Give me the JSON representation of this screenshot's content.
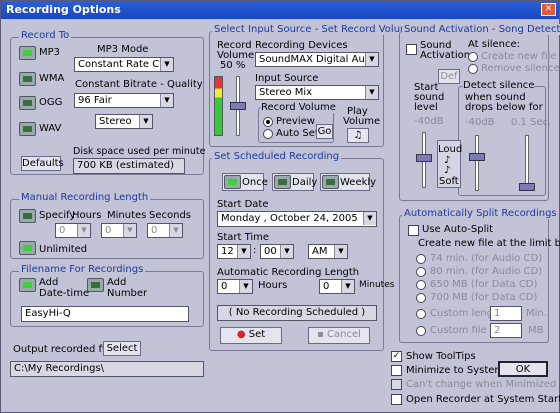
{
  "window": {
    "title": "Recording Options"
  },
  "record_to": {
    "title": "Record To",
    "formats": [
      "MP3",
      "WMA",
      "OGG",
      "WAV"
    ],
    "mp3_mode_label": "MP3 Mode",
    "mp3_mode_value": "Constant Rate CBR",
    "bitrate_label": "Constant Bitrate - Quality",
    "bitrate_value": "96   Fair",
    "channels_value": "Stereo",
    "defaults_label": "Defaults",
    "disk_label": "Disk space used per minute",
    "disk_value": "700  KB (estimated)"
  },
  "manual_length": {
    "title": "Manual Recording Length",
    "specify_label": "Specify",
    "hours_label": "Hours",
    "minutes_label": "Minutes",
    "seconds_label": "Seconds",
    "hours_value": "0",
    "minutes_value": "0",
    "seconds_value": "0",
    "unlimited_label": "Unlimited"
  },
  "filename": {
    "title": "Filename For Recordings",
    "add_datetime_label": "Add Date-time",
    "add_datetime_1": "Add",
    "add_datetime_2": "Date-time",
    "add_number_1": "Add",
    "add_number_2": "Number",
    "value": "EasyHi-Q"
  },
  "output": {
    "label": "Output recorded files to",
    "select_label": "Select",
    "path": "C:\\My Recordings\\"
  },
  "input_source": {
    "title": "Select Input Source - Set Record Volume",
    "volume_label_1": "Record",
    "volume_label_2": "Volume",
    "volume_value": "50 %",
    "volume_level": 0.5,
    "devices_label": "Recording Devices",
    "device_value": "SoundMAX Digital Audio",
    "source_label": "Input Source",
    "source_value": "Stereo Mix",
    "record_volume_label": "Record Volume",
    "preview_label": "Preview",
    "autoset_label": "Auto Set",
    "go_label": "Go",
    "play_volume_1": "Play",
    "play_volume_2": "Volume"
  },
  "scheduled": {
    "title": "Set Scheduled Recording",
    "once_label": "Once",
    "daily_label": "Daily",
    "weekly_label": "Weekly",
    "start_date_label": "Start Date",
    "start_date_value": "Monday    ,  October   24, 2005",
    "start_time_label": "Start Time",
    "time_hour": "12",
    "time_min": "00",
    "time_ampm": "AM",
    "auto_length_label": "Automatic Recording Length",
    "hours_value": "0",
    "hours_label": "Hours",
    "minutes_value": "0",
    "minutes_label": "Minutes",
    "status": "( No Recording Scheduled )",
    "set_label": "Set",
    "cancel_label": "Cancel"
  },
  "sound_activation": {
    "title": "Sound Activation - Song Detection",
    "activation_1": "Sound",
    "activation_2": "Activation",
    "at_silence_label": "At silence:",
    "create_new_label": "Create new file",
    "remove_silence_label": "Remove silence",
    "def_label": "Def",
    "start_level_1": "Start",
    "start_level_2": "sound",
    "start_level_3": "level",
    "detect_title": "Detect silence",
    "detect_1": "when sound",
    "detect_2": "drops below",
    "detect_for": "for",
    "start_db": "-40dB",
    "detect_db": "-40dB",
    "detect_sec": "0.1 Sec.",
    "loud_label": "Loud",
    "soft_label": "Soft"
  },
  "auto_split": {
    "title": "Automatically Split Recordings",
    "use_label": "Use Auto-Split",
    "limit_label": "Create new file at the limit below",
    "options": [
      "74 min. (for Audio CD)",
      "80 min. (for Audio CD)",
      "650 MB (for Data CD)",
      "700 MB (for Data CD)"
    ],
    "custom_length_label": "Custom length",
    "custom_length_value": "1",
    "custom_length_unit": "Min.",
    "custom_size_label": "Custom file size",
    "custom_size_value": "2",
    "custom_size_unit": "MB"
  },
  "bottom": {
    "show_tooltips": "Show ToolTips",
    "minimize_tray": "Minimize to System Tray",
    "cant_change": "Can't change when Minimized",
    "open_startup": "Open Recorder at System Startup",
    "ok_label": "OK"
  }
}
